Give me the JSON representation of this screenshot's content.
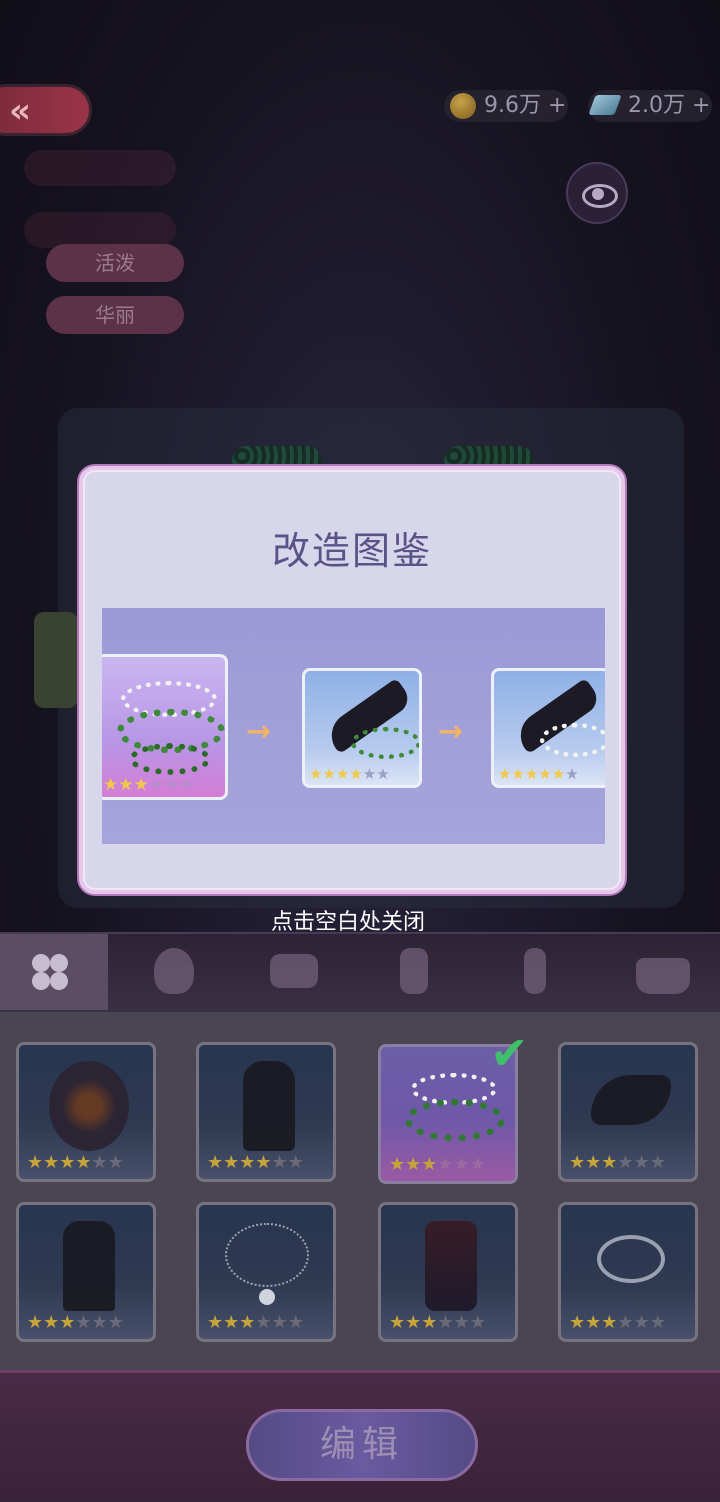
{
  "header": {
    "back_icon": "double-chevron-left",
    "currencies": [
      {
        "icon": "coin-icon",
        "text": "9.6万",
        "plus": "+"
      },
      {
        "icon": "crystal-icon",
        "text": "2.0万",
        "plus": "+"
      }
    ],
    "eye_icon": "eye-icon"
  },
  "tags": [
    "活泼",
    "华丽"
  ],
  "modal": {
    "title": "改造图鉴",
    "stages": [
      {
        "name": "necklace",
        "stars_filled": 3,
        "stars_total": 6
      },
      {
        "name": "gloves-with-beads",
        "stars_filled": 4,
        "stars_total": 6
      },
      {
        "name": "gloves-with-pearls",
        "stars_filled": 5,
        "stars_total": 6
      }
    ],
    "arrow": "→",
    "hint": "点击空白处关闭"
  },
  "tabs": [
    "clover-icon",
    "head-icon",
    "top-icon",
    "pants-icon",
    "leg-icon",
    "bag-icon"
  ],
  "items": [
    {
      "name": "crown",
      "stars_filled": 4,
      "stars_total": 6
    },
    {
      "name": "dress-dark",
      "stars_filled": 4,
      "stars_total": 6
    },
    {
      "name": "necklace",
      "stars_filled": 3,
      "stars_total": 6,
      "selected": true
    },
    {
      "name": "hair-accessory",
      "stars_filled": 3,
      "stars_total": 6
    },
    {
      "name": "gown",
      "stars_filled": 3,
      "stars_total": 6
    },
    {
      "name": "chain-necklace",
      "stars_filled": 3,
      "stars_total": 6
    },
    {
      "name": "long-dress",
      "stars_filled": 3,
      "stars_total": 6
    },
    {
      "name": "bracelet",
      "stars_filled": 3,
      "stars_total": 6
    }
  ],
  "bottom": {
    "edit_label": "编辑"
  },
  "colors": {
    "accent": "#5a5388",
    "star": "#f2c848",
    "check": "#3fbf6a"
  }
}
